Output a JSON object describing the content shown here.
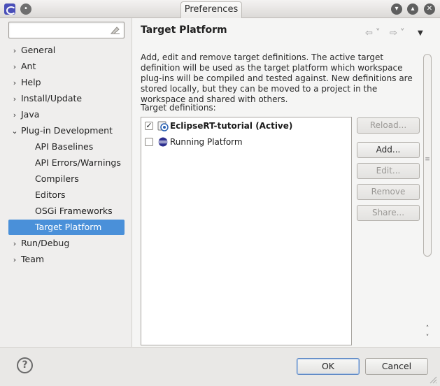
{
  "window": {
    "title": "Preferences",
    "menu_glyph": "•",
    "controls": {
      "minimize": "▾",
      "maximize": "▴",
      "close": "✕"
    }
  },
  "sidebar": {
    "filter": {
      "value": "",
      "placeholder": ""
    },
    "items": [
      {
        "label": "General",
        "arrow": "›"
      },
      {
        "label": "Ant",
        "arrow": "›"
      },
      {
        "label": "Help",
        "arrow": "›"
      },
      {
        "label": "Install/Update",
        "arrow": "›"
      },
      {
        "label": "Java",
        "arrow": "›"
      },
      {
        "label": "Plug-in Development",
        "arrow": "⌄"
      },
      {
        "label": "API Baselines"
      },
      {
        "label": "API Errors/Warnings"
      },
      {
        "label": "Compilers"
      },
      {
        "label": "Editors"
      },
      {
        "label": "OSGi Frameworks"
      },
      {
        "label": "Target Platform",
        "selected": true
      },
      {
        "label": "Run/Debug",
        "arrow": "›"
      },
      {
        "label": "Team",
        "arrow": "›"
      }
    ]
  },
  "main": {
    "title": "Target Platform",
    "nav": {
      "back": "⇦ ˅",
      "forward": "⇨ ˅",
      "menu": "▼"
    },
    "description": "Add, edit and remove target definitions.  The active target definition will be used as the target platform which workspace plug-ins will be compiled and tested against.  New definitions are stored locally, but they can be moved to a project in the workspace and shared with others.",
    "definitions_label": "Target definitions:",
    "definitions": [
      {
        "label": "EclipseRT-tutorial (Active)",
        "checked": true,
        "check_glyph": "✓",
        "bold": true
      },
      {
        "label": "Running Platform",
        "checked": false,
        "check_glyph": ""
      }
    ],
    "buttons": {
      "reload": "Reload...",
      "add": "Add...",
      "edit": "Edit...",
      "remove": "Remove",
      "share": "Share..."
    },
    "scroll": {
      "up": "˄",
      "down": "˅",
      "grip": "≡"
    }
  },
  "footer": {
    "help": "?",
    "ok": "OK",
    "cancel": "Cancel"
  },
  "colors": {
    "selection": "#4a90d9",
    "window_bg": "#e9e8e6"
  }
}
